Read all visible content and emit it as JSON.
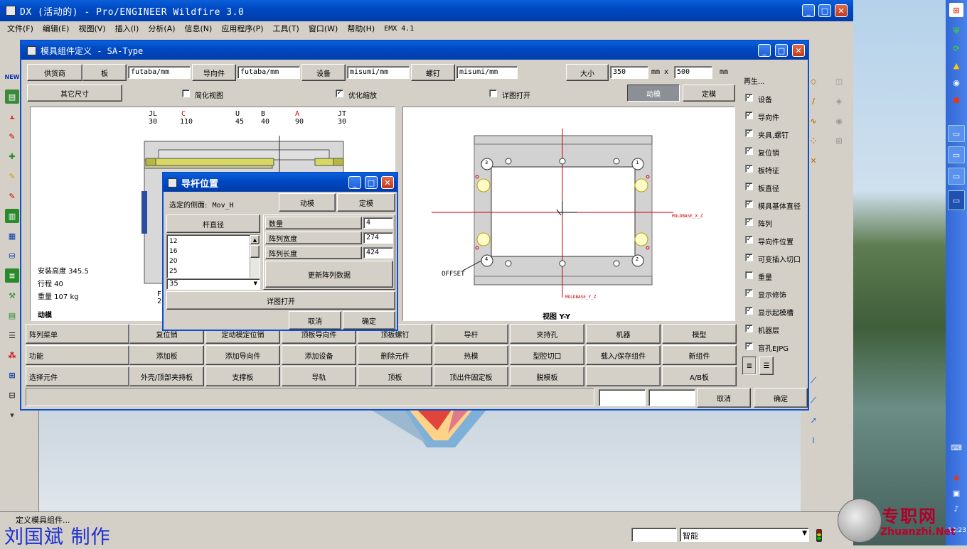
{
  "app": {
    "title": "DX (活动的) - Pro/ENGINEER Wildfire 3.0",
    "menu": [
      "文件(F)",
      "编辑(E)",
      "视图(V)",
      "插入(I)",
      "分析(A)",
      "信息(N)",
      "应用程序(P)",
      "工具(T)",
      "窗口(W)",
      "帮助(H)",
      "EMX 4.1"
    ],
    "status_message": "定义模具组件...",
    "filter_value": "智能",
    "watermark_author": "刘国斌 制作",
    "watermark_site_cn": "专职网",
    "watermark_site_en": "Zhuanzhi.Net",
    "clock": "13:23"
  },
  "main_dialog": {
    "title": "模具组件定义 - SA-Type",
    "supplier_label": "供货商",
    "plate_btn": "板",
    "plate_value": "futaba/mm",
    "guide_btn": "导向件",
    "guide_value": "futaba/mm",
    "equip_btn": "设备",
    "equip_value": "misumi/mm",
    "screw_btn": "螺钉",
    "screw_value": "misumi/mm",
    "size_btn": "大小",
    "size_x": "350",
    "size_unit1": "mm x",
    "size_y": "500",
    "size_unit2": "mm",
    "other_size_btn": "其它尺寸",
    "simplify_label": "简化视图",
    "optimize_label": "优化缩放",
    "detail_label": "详图打开",
    "moving_btn": "动模",
    "fixed_btn": "定模",
    "left_view": {
      "col_labels": [
        {
          "name": "JL",
          "val": "30"
        },
        {
          "name": "C",
          "val": "110"
        },
        {
          "name": "U",
          "val": "45"
        },
        {
          "name": "B",
          "val": "40"
        },
        {
          "name": "A",
          "val": "90"
        },
        {
          "name": "JT",
          "val": "30"
        }
      ],
      "install_height": "安装高度 345.5",
      "stroke": "行程 40",
      "weight": "重量 107 kg",
      "caption": "动模",
      "f_label": "F",
      "f_val": "2"
    },
    "right_view": {
      "caption": "视图 Y-Y",
      "offset_label": "OFFSET",
      "axis_x_label": "MOLDBASE_X_Z",
      "axis_y_label": "MOLDBASE_Y_Z",
      "corner_labels": [
        "3",
        "1",
        "4",
        "2"
      ]
    },
    "right_panel": {
      "header": "再生...",
      "items": [
        {
          "label": "设备",
          "checked": true
        },
        {
          "label": "导向件",
          "checked": true
        },
        {
          "label": "夹具,螺钉",
          "checked": true
        },
        {
          "label": "复位销",
          "checked": true
        },
        {
          "label": "板特征",
          "checked": true
        },
        {
          "label": "板直径",
          "checked": true
        },
        {
          "label": "模具基体直径",
          "checked": true
        },
        {
          "label": "阵列",
          "checked": true
        },
        {
          "label": "导向件位置",
          "checked": true
        },
        {
          "label": "可变插入切口",
          "checked": true
        },
        {
          "label": "重量",
          "checked": false
        },
        {
          "label": "显示修饰",
          "checked": true
        },
        {
          "label": "显示起模槽",
          "checked": true
        },
        {
          "label": "机器层",
          "checked": true
        },
        {
          "label": "盲孔EJPG",
          "checked": true
        }
      ]
    },
    "rows": [
      {
        "label": "阵列菜单",
        "buttons": [
          "复位销",
          "定动模定位销",
          "顶板导向件",
          "顶板螺钉",
          "导杆",
          "夹持孔",
          "机器",
          "模型"
        ]
      },
      {
        "label": "功能",
        "buttons": [
          "添加板",
          "添加导向件",
          "添加设备",
          "删除元件",
          "热模",
          "型腔切口",
          "载入/保存组件",
          "新组件"
        ]
      },
      {
        "label": "选择元件",
        "buttons": [
          "外壳/顶部夹持板",
          "支撑板",
          "导轨",
          "顶板",
          "顶出件固定板",
          "脱模板",
          "",
          "A/B板"
        ]
      }
    ],
    "cancel_btn": "取消",
    "ok_btn": "确定"
  },
  "sub_dialog": {
    "title": "导杆位置",
    "side_label": "选定的侧面: ",
    "side_value": "Mov_H",
    "moving_btn": "动模",
    "fixed_btn": "定模",
    "diameter_btn": "杆直径",
    "diameters": [
      "12",
      "16",
      "20",
      "25"
    ],
    "selected_diameter": "35",
    "count_label": "数量",
    "count_value": "4",
    "width_label": "阵列宽度",
    "width_value": "274",
    "length_label": "阵列长度",
    "length_value": "424",
    "update_btn": "更新阵列数据",
    "detail_btn": "详图打开",
    "cancel_btn": "取消",
    "ok_btn": "确定"
  },
  "colors": {
    "titlebar": "#0a5fd8",
    "window_bg": "#d4d0c8",
    "pressed_btn": "#8c9096",
    "datum_red": "#cc0000",
    "plate_gray": "#c8c8c8"
  }
}
